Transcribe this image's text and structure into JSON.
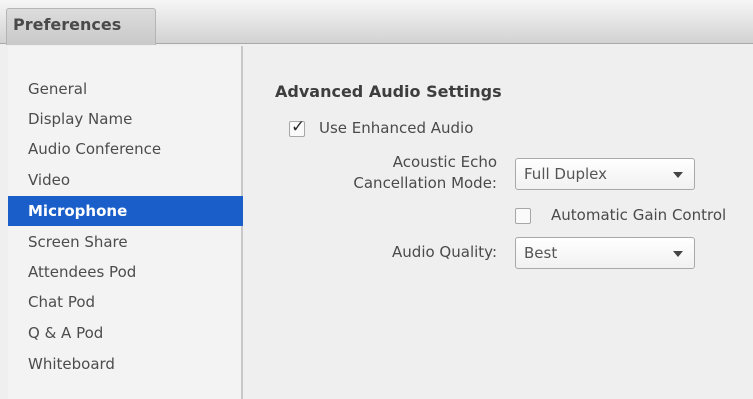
{
  "window": {
    "title": "Preferences"
  },
  "sidebar": {
    "items": [
      {
        "label": "General"
      },
      {
        "label": "Display Name"
      },
      {
        "label": "Audio Conference"
      },
      {
        "label": "Video"
      },
      {
        "label": "Microphone",
        "selected": true
      },
      {
        "label": "Screen Share"
      },
      {
        "label": "Attendees Pod"
      },
      {
        "label": "Chat Pod"
      },
      {
        "label": "Q & A Pod"
      },
      {
        "label": "Whiteboard"
      }
    ]
  },
  "main": {
    "section_title": "Advanced Audio Settings",
    "enhanced_audio": {
      "label": "Use Enhanced Audio",
      "checked": true
    },
    "echo_cancellation": {
      "label_line1": "Acoustic Echo",
      "label_line2": "Cancellation Mode:",
      "value": "Full Duplex"
    },
    "gain_control": {
      "label": "Automatic Gain Control",
      "checked": false
    },
    "audio_quality": {
      "label": "Audio Quality:",
      "value": "Best"
    }
  },
  "colors": {
    "selection": "#1a5fc9",
    "background": "#efefef"
  }
}
